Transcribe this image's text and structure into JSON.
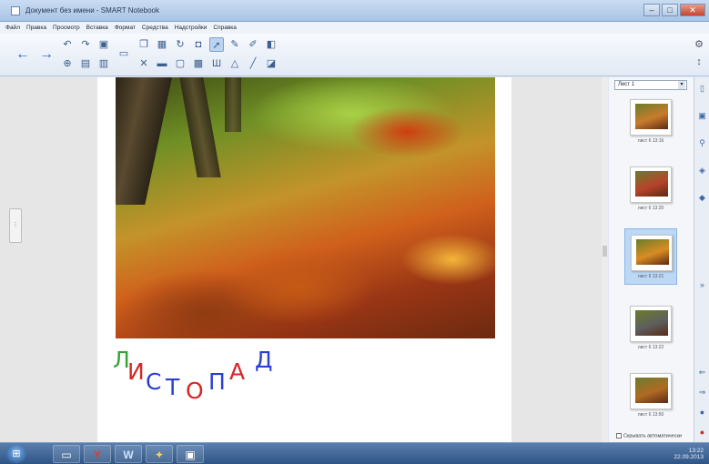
{
  "window": {
    "title": "Документ без имени - SMART Notebook",
    "controls": {
      "minimize": "‒",
      "maximize": "□",
      "close": "✕"
    }
  },
  "menubar": {
    "items": [
      "Файл",
      "Правка",
      "Просмотр",
      "Вставка",
      "Формат",
      "Средства",
      "Надстройки",
      "Справка"
    ]
  },
  "toolbar": {
    "back_icon": "arrow-left-icon",
    "forward_icon": "arrow-right-icon",
    "selected_tool": "select-pointer"
  },
  "page": {
    "word_letters": [
      {
        "char": "Л",
        "color": "#33a532"
      },
      {
        "char": "И",
        "color": "#d62626"
      },
      {
        "char": "С",
        "color": "#2a3fd1"
      },
      {
        "char": "Т",
        "color": "#2a3fd1"
      },
      {
        "char": "О",
        "color": "#d62626"
      },
      {
        "char": "П",
        "color": "#2a3fd1"
      },
      {
        "char": "А",
        "color": "#d62626"
      },
      {
        "char": "Д",
        "color": "#2a3fd1"
      }
    ]
  },
  "page_sorter": {
    "dropdown_value": "Лист 1",
    "thumbnails": [
      {
        "caption": "лист 6 13:16",
        "active": false,
        "tone": "#c97b2c"
      },
      {
        "caption": "лист 6 13:20",
        "active": false,
        "tone": "#b8432b"
      },
      {
        "caption": "лист 6 13:21",
        "active": true,
        "tone": "#d98c23"
      },
      {
        "caption": "лист 6 13:22",
        "active": false,
        "tone": "#5e5e5e"
      },
      {
        "caption": "лист 6 13:50",
        "active": false,
        "tone": "#b06a24"
      }
    ],
    "auto_hide_label": "Скрывать автоматически"
  },
  "taskbar": {
    "clock_time": "13:22",
    "clock_date": "22.09.2013"
  },
  "colors": {
    "accent": "#2a67b8",
    "taskbar": "#2f5586"
  }
}
